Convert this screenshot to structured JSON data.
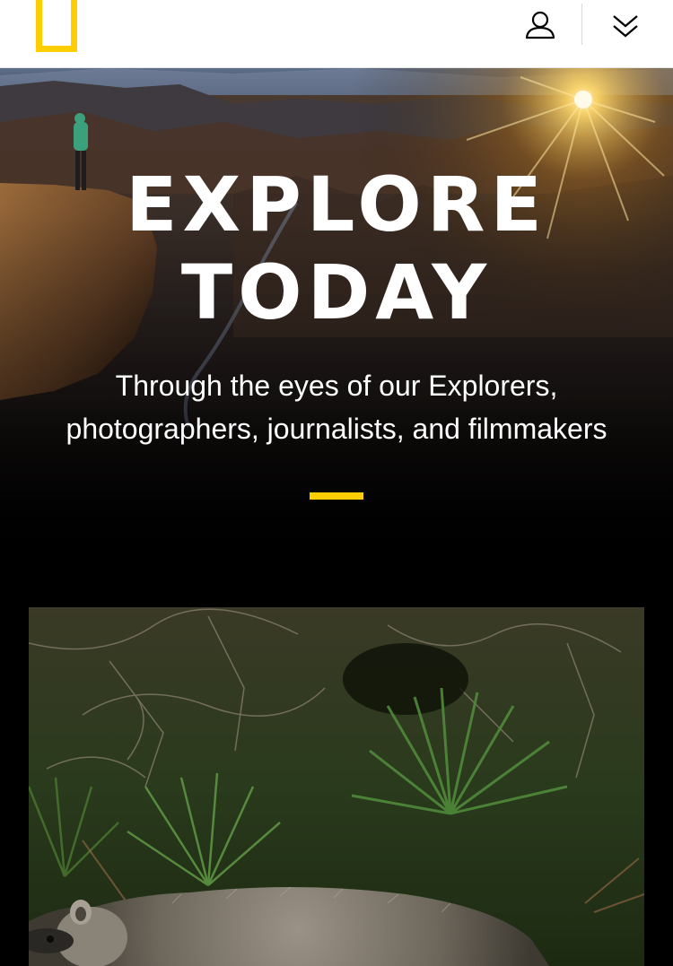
{
  "header": {
    "logo_name": "yellow-border-logo",
    "account_icon": "user-icon",
    "menu_icon": "double-chevron-down-icon",
    "brand_color": "#FFCE00"
  },
  "hero": {
    "title_line1": "EXPLORE",
    "title_line2": "TODAY",
    "subtitle_line1": "Through the eyes of our Explorers,",
    "subtitle_line2": "photographers, journalists, and filmmakers",
    "image": "canyon-sunset-with-explorer-photo"
  },
  "feature": {
    "image": "raccoon-in-palmetto-brush-photo"
  }
}
